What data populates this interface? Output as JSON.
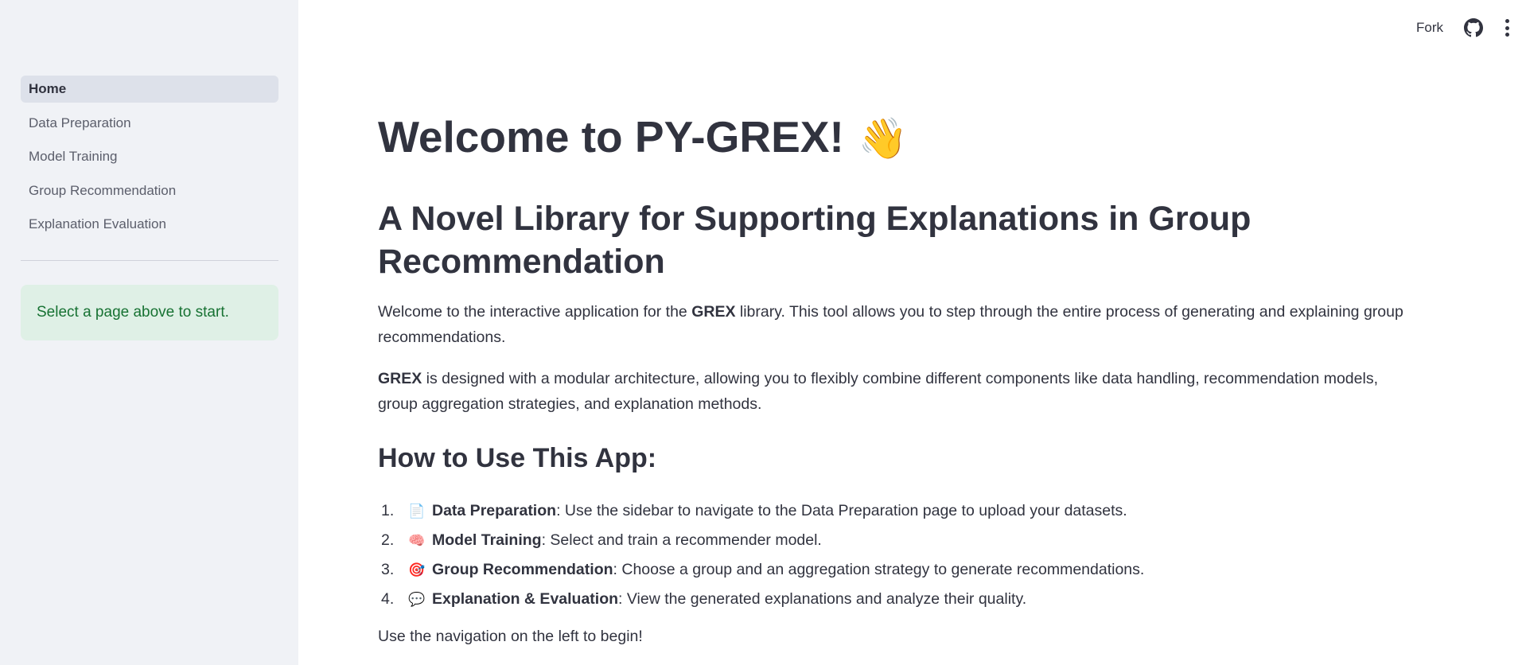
{
  "sidebar": {
    "items": [
      {
        "label": "Home",
        "active": true
      },
      {
        "label": "Data Preparation",
        "active": false
      },
      {
        "label": "Model Training",
        "active": false
      },
      {
        "label": "Group Recommendation",
        "active": false
      },
      {
        "label": "Explanation Evaluation",
        "active": false
      }
    ],
    "info_message": "Select a page above to start."
  },
  "toolbar": {
    "fork_label": "Fork",
    "github_icon": "github-icon",
    "menu_icon": "more-vertical-icon"
  },
  "main": {
    "title": "Welcome to PY-GREX!",
    "title_emoji": "👋",
    "subtitle": "A Novel Library for Supporting Explanations in Group Recommendation",
    "intro": {
      "before": "Welcome to the interactive application for the ",
      "bold": "GREX",
      "after": " library. This tool allows you to step through the entire process of generating and explaining group recommendations."
    },
    "design": {
      "bold": "GREX",
      "after": " is designed with a modular architecture, allowing you to flexibly combine different components like data handling, recommendation models, group aggregation strategies, and explanation methods."
    },
    "howto_heading": "How to Use This App:",
    "steps": [
      {
        "num": "1.",
        "emoji": "📄",
        "bold": "Data Preparation",
        "text": ": Use the sidebar to navigate to the Data Preparation page to upload your datasets."
      },
      {
        "num": "2.",
        "emoji": "🧠",
        "bold": "Model Training",
        "text": ": Select and train a recommender model."
      },
      {
        "num": "3.",
        "emoji": "🎯",
        "bold": "Group Recommendation",
        "text": ": Choose a group and an aggregation strategy to generate recommendations."
      },
      {
        "num": "4.",
        "emoji": "💬",
        "bold": "Explanation & Evaluation",
        "text": ": View the generated explanations and analyze their quality."
      }
    ],
    "footer_text": "Use the navigation on the left to begin!"
  },
  "colors": {
    "sidebar_bg": "#f0f2f6",
    "active_nav_bg": "#dde1ea",
    "info_bg": "#dff0e6",
    "info_text": "#177233",
    "text": "#31333f"
  }
}
